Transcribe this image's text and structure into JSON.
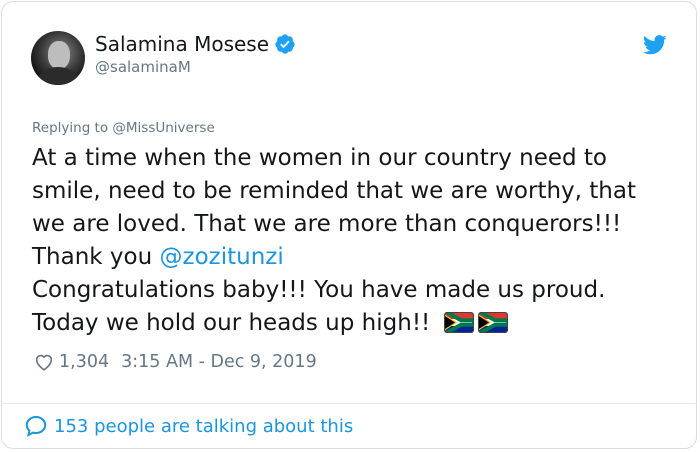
{
  "tweet": {
    "author_name": "Salamina Mosese",
    "author_handle": "@salaminaM",
    "replying_prefix": "Replying to",
    "replying_to": "@MissUniverse",
    "lines": [
      "At a time when the women in our country need to",
      "smile, need to be reminded that we are worthy, that",
      "we are loved. That we are more than conquerors!!!"
    ],
    "thank_you": "Thank you",
    "mention": "@zozitunzi",
    "line5": "Congratulations baby!!! You have made us proud.",
    "line6": "Today we hold our heads up high!!",
    "flag_icons": [
      "south-africa-flag-icon",
      "south-africa-flag-icon"
    ],
    "likes": "1,304",
    "timestamp": "3:15 AM - Dec 9, 2019",
    "talking": "153 people are talking about this"
  },
  "colors": {
    "link": "#1b95e0",
    "text": "#14171a",
    "muted": "#657786",
    "verified": "#1da1f2",
    "twitter_bird": "#1da1f2"
  }
}
